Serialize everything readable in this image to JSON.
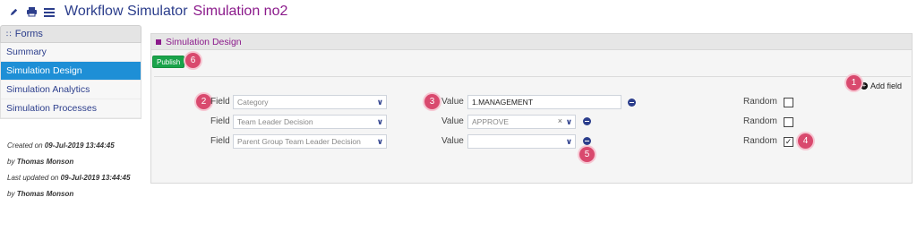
{
  "header": {
    "title": "Workflow Simulator",
    "subtitle": "Simulation no2",
    "icons": [
      "pencil-icon",
      "print-icon",
      "hamburger-icon"
    ]
  },
  "sidebar": {
    "heading": "Forms",
    "items": [
      {
        "label": "Summary",
        "active": false
      },
      {
        "label": "Simulation Design",
        "active": true
      },
      {
        "label": "Simulation Analytics",
        "active": false
      },
      {
        "label": "Simulation Processes",
        "active": false
      }
    ]
  },
  "meta": {
    "created_prefix": "Created on",
    "created_date": "09-Jul-2019 13:44:45",
    "by1_prefix": "by",
    "by1_name": "Thomas Monson",
    "updated_prefix": "Last updated on",
    "updated_date": "09-Jul-2019 13:44:45",
    "by2_prefix": "by",
    "by2_name": "Thomas Monson"
  },
  "panel": {
    "title": "Simulation Design",
    "publish_label": "Publish",
    "add_field_label": "Add field",
    "rows": [
      {
        "field_label": "Field",
        "field_value": "Category",
        "value_label": "Value",
        "value": "1.MANAGEMENT",
        "random_label": "Random",
        "random_checked": false
      },
      {
        "field_label": "Field",
        "field_value": "Team Leader Decision",
        "value_label": "Value",
        "value": "APPROVE",
        "random_label": "Random",
        "random_checked": false
      },
      {
        "field_label": "Field",
        "field_value": "Parent Group Team Leader Decision",
        "value_label": "Value",
        "value": "",
        "random_label": "Random",
        "random_checked": true
      }
    ]
  },
  "badges": [
    "1",
    "2",
    "3",
    "4",
    "5",
    "6"
  ],
  "colors": {
    "accent": "#1e8fd6",
    "title": "#2c3e8c",
    "brand": "#8b1a8b",
    "publish": "#1aa34a",
    "badge": "#d9496e"
  }
}
